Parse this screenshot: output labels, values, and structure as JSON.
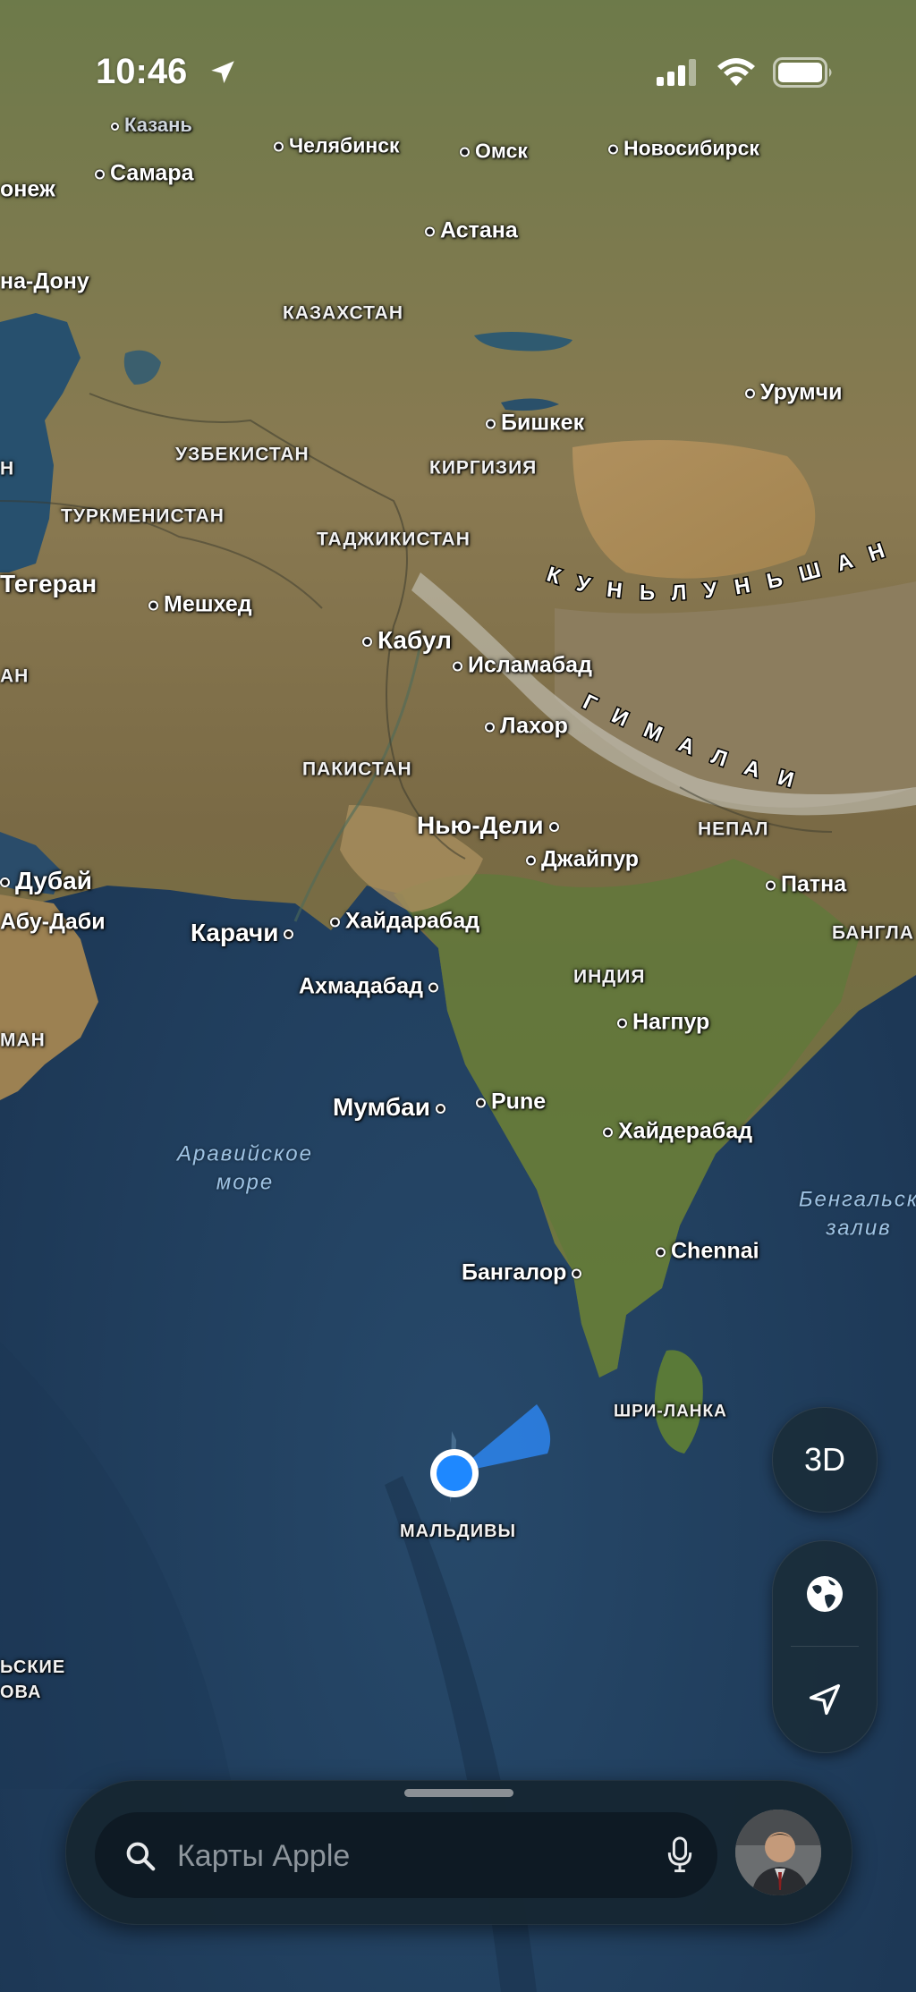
{
  "status_bar": {
    "time": "10:46"
  },
  "map": {
    "cities": [
      {
        "id": "kazan",
        "name": "Казань",
        "style": "faded"
      },
      {
        "id": "samara",
        "name": "Самара"
      },
      {
        "id": "voronezh",
        "name": "онеж"
      },
      {
        "id": "chelyabinsk",
        "name": "Челябинск"
      },
      {
        "id": "omsk",
        "name": "Омск"
      },
      {
        "id": "novosibirsk",
        "name": "Новосибирск"
      },
      {
        "id": "astana",
        "name": "Астана"
      },
      {
        "id": "rostov",
        "name": "на-Дону"
      },
      {
        "id": "urumqi",
        "name": "Урумчи"
      },
      {
        "id": "bishkek",
        "name": "Бишкек"
      },
      {
        "id": "tehran",
        "name": "Тегеран"
      },
      {
        "id": "mashhad",
        "name": "Мешхед"
      },
      {
        "id": "kabul",
        "name": "Кабул"
      },
      {
        "id": "islamabad",
        "name": "Исламабад"
      },
      {
        "id": "lahore",
        "name": "Лахор"
      },
      {
        "id": "newdelhi",
        "name": "Нью-Дели"
      },
      {
        "id": "jaipur",
        "name": "Джайпур"
      },
      {
        "id": "patna",
        "name": "Патна"
      },
      {
        "id": "dubai",
        "name": "Дубай"
      },
      {
        "id": "abudhabi",
        "name": "Абу-Даби"
      },
      {
        "id": "karachi",
        "name": "Карачи"
      },
      {
        "id": "hyderabad_pk",
        "name": "Хайдарабад"
      },
      {
        "id": "ahmedabad",
        "name": "Ахмадабад"
      },
      {
        "id": "nagpur",
        "name": "Нагпур"
      },
      {
        "id": "mumbai",
        "name": "Мумбаи"
      },
      {
        "id": "pune",
        "name": "Pune"
      },
      {
        "id": "hyderabad_in",
        "name": "Хайдерабад"
      },
      {
        "id": "bangalore",
        "name": "Бангалор"
      },
      {
        "id": "chennai",
        "name": "Chennai"
      }
    ],
    "countries": [
      {
        "id": "kazakhstan",
        "name": "КАЗАХСТАН"
      },
      {
        "id": "uzbekistan",
        "name": "УЗБЕКИСТАН"
      },
      {
        "id": "kyrgyzstan",
        "name": "КИРГИЗИЯ"
      },
      {
        "id": "turkmenistan",
        "name": "ТУРКМЕНИСТАН"
      },
      {
        "id": "tajikistan",
        "name": "ТАДЖИКИСТАН"
      },
      {
        "id": "pakistan",
        "name": "ПАКИСТАН"
      },
      {
        "id": "nepal",
        "name": "НЕПАЛ"
      },
      {
        "id": "india",
        "name": "ИНДИЯ"
      },
      {
        "id": "bangladesh",
        "name": "БАНГЛА"
      },
      {
        "id": "srilanka",
        "name": "ШРИ-ЛАНКА"
      },
      {
        "id": "maldives",
        "name": "МАЛЬДИВЫ"
      },
      {
        "id": "oman",
        "name": "МАН"
      },
      {
        "id": "iran_fragment",
        "name": "АН"
      },
      {
        "id": "edge_h",
        "name": "Н"
      },
      {
        "id": "seychelles_1",
        "name": "ЬСКИЕ"
      },
      {
        "id": "seychelles_2",
        "name": "ОВА"
      }
    ],
    "water": [
      {
        "id": "arabian_sea",
        "line1": "Аравийское",
        "line2": "море"
      },
      {
        "id": "bay_of_bengal",
        "line1": "Бенгальск",
        "line2": "залив"
      }
    ],
    "mountains": [
      {
        "id": "kunlun",
        "name": "КУНЬЛУНЬШАН"
      },
      {
        "id": "himalaya",
        "name": "ГИМАЛАИ"
      }
    ]
  },
  "controls": {
    "three_d_label": "3D"
  },
  "search": {
    "placeholder": "Карты Apple"
  },
  "colors": {
    "user_location": "#1e88ff",
    "panel_bg": "#162632",
    "ocean": "#1f3f5c"
  }
}
